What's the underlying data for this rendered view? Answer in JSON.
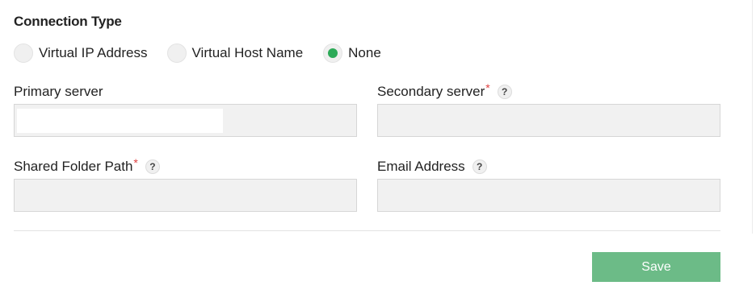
{
  "connection_type": {
    "title": "Connection Type",
    "options": [
      {
        "label": "Virtual IP Address",
        "selected": false
      },
      {
        "label": "Virtual Host Name",
        "selected": false
      },
      {
        "label": "None",
        "selected": true
      }
    ],
    "selected_color": "#2daa58"
  },
  "fields": {
    "primary_server": {
      "label": "Primary server",
      "required": false,
      "help": false,
      "value": ""
    },
    "secondary_server": {
      "label": "Secondary server",
      "required_mark": "*",
      "help_icon": "?",
      "value": ""
    },
    "shared_folder_path": {
      "label": "Shared Folder Path",
      "required_mark": "*",
      "help_icon": "?",
      "value": ""
    },
    "email_address": {
      "label": "Email Address",
      "help_icon": "?",
      "value": ""
    }
  },
  "actions": {
    "save_label": "Save",
    "save_color": "#6cbb87"
  }
}
